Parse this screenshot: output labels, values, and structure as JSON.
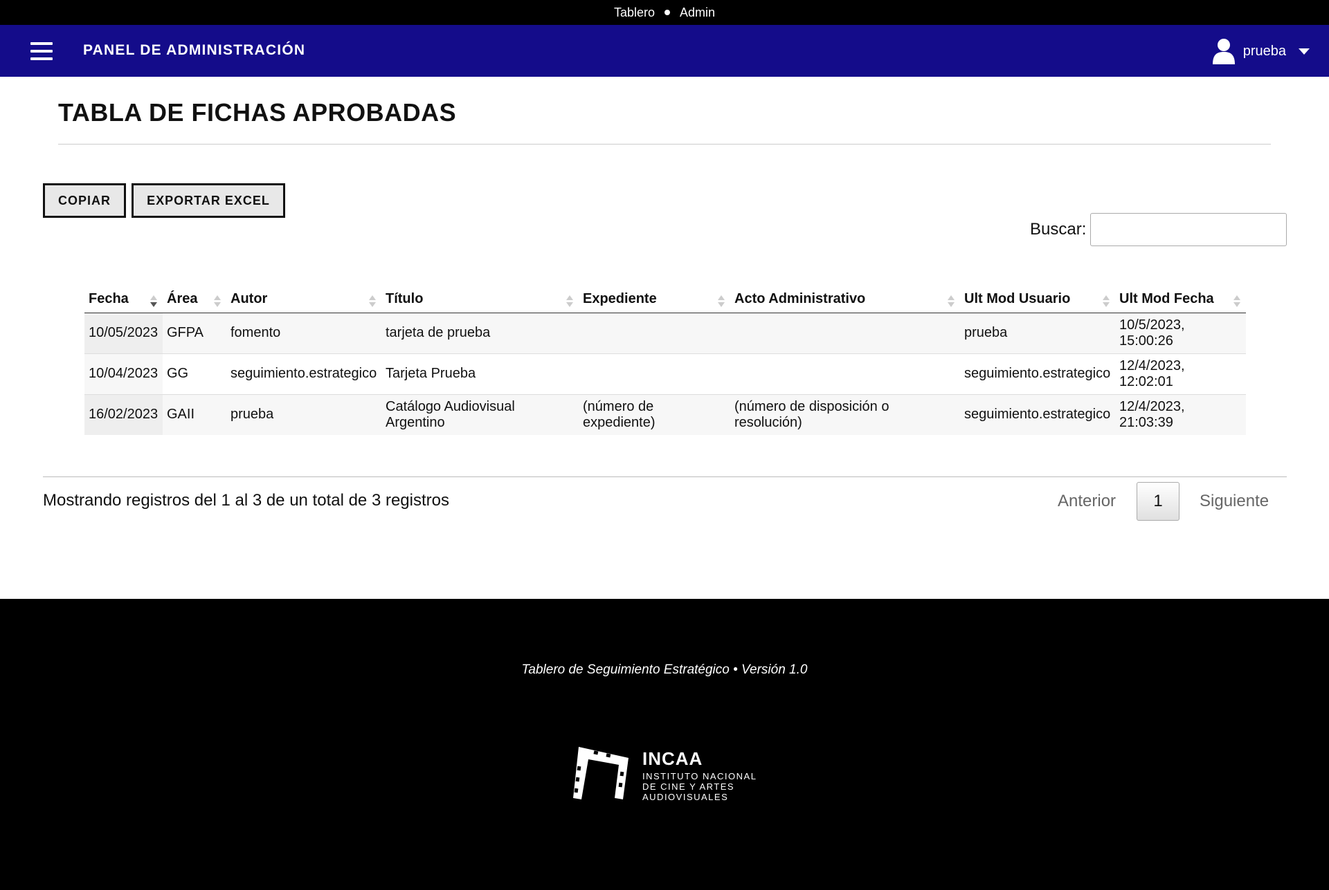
{
  "topbar": {
    "left": "Tablero",
    "right": "Admin"
  },
  "navbar": {
    "brand": "PANEL DE ADMINISTRACIÓN",
    "user": "prueba"
  },
  "page": {
    "title": "TABLA DE FICHAS APROBADAS"
  },
  "toolbar": {
    "copy_label": "COPIAR",
    "excel_label": "EXPORTAR EXCEL",
    "search_label": "Buscar:",
    "search_value": ""
  },
  "table": {
    "columns": [
      "Fecha",
      "Área",
      "Autor",
      "Título",
      "Expediente",
      "Acto Administrativo",
      "Ult Mod Usuario",
      "Ult Mod Fecha"
    ],
    "sorted_column": "Fecha",
    "rows": [
      [
        "10/05/2023",
        "GFPA",
        "fomento",
        "tarjeta de prueba",
        "",
        "",
        "prueba",
        "10/5/2023, 15:00:26"
      ],
      [
        "10/04/2023",
        "GG",
        "seguimiento.estrategico",
        "Tarjeta Prueba",
        "",
        "",
        "seguimiento.estrategico",
        "12/4/2023, 12:02:01"
      ],
      [
        "16/02/2023",
        "GAII",
        "prueba",
        "Catálogo Audiovisual Argentino",
        "(número de expediente)",
        "(número de disposición o resolución)",
        "seguimiento.estrategico",
        "12/4/2023, 21:03:39"
      ]
    ]
  },
  "pagination": {
    "info": "Mostrando registros del 1 al 3 de un total de 3 registros",
    "prev": "Anterior",
    "page": "1",
    "next": "Siguiente"
  },
  "footer": {
    "text": "Tablero de Seguimiento Estratégico • Versión 1.0",
    "logo_name": "INCAA",
    "logo_line1": "INSTITUTO NACIONAL",
    "logo_line2": "DE CINE Y ARTES",
    "logo_line3": "AUDIOVISUALES"
  },
  "colors": {
    "navbar": "#140c8a",
    "topbar": "#000000",
    "footer": "#000000"
  },
  "icons": {
    "menu": "hamburger-icon",
    "user": "user-icon",
    "dropdown": "caret-down-icon",
    "sort": "sort-icon"
  }
}
